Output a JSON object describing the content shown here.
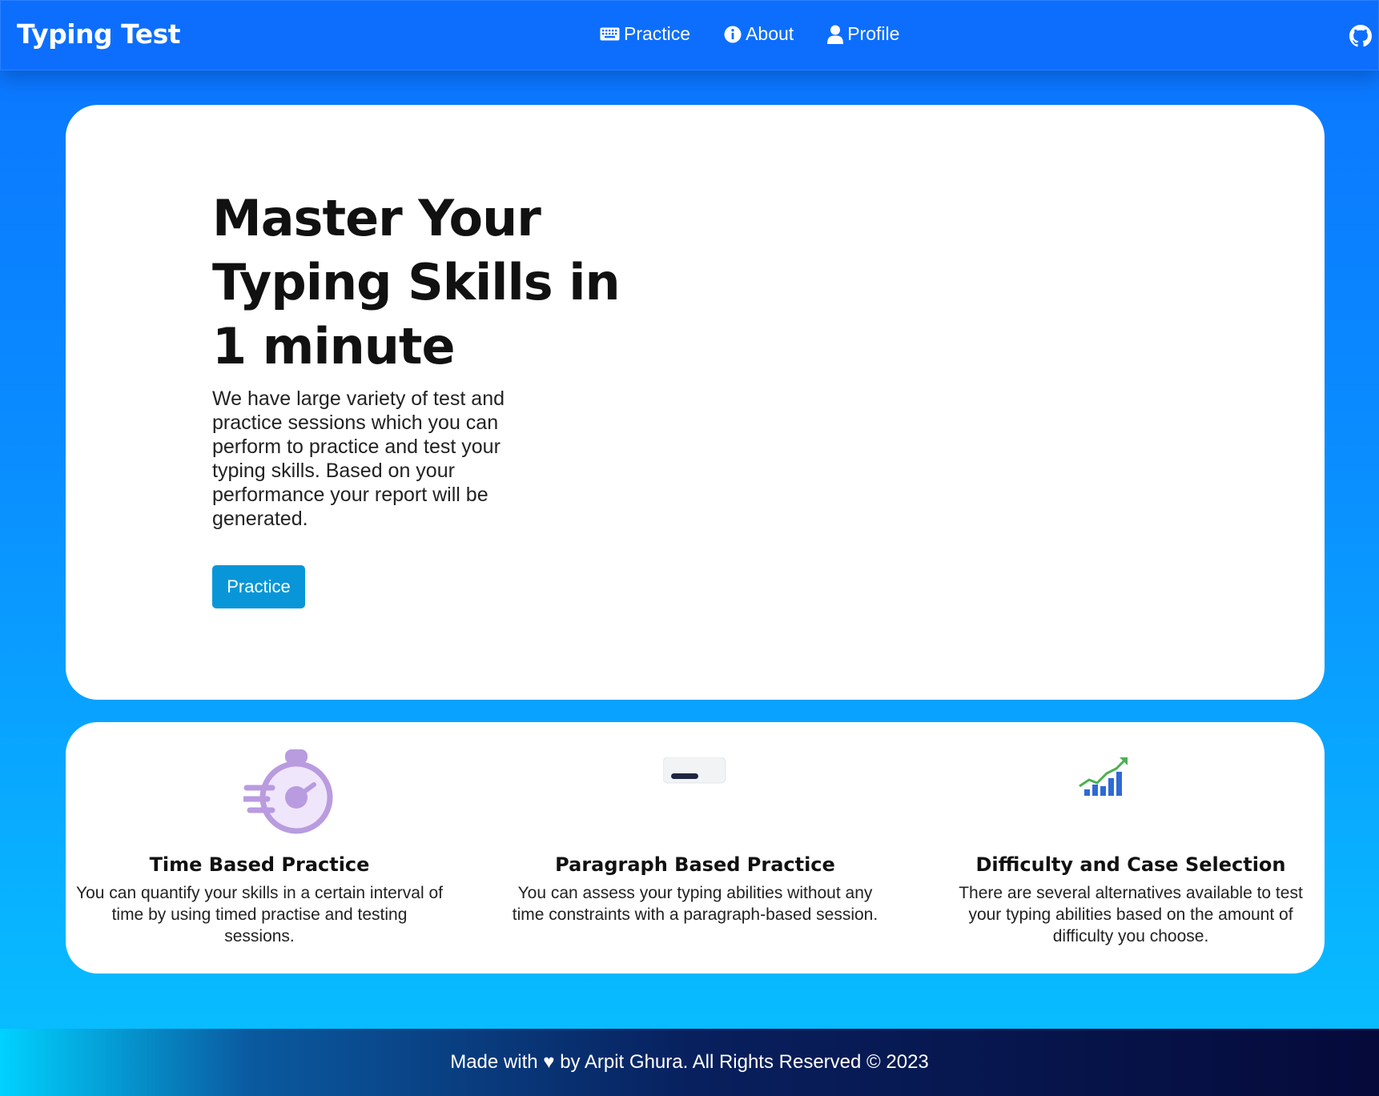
{
  "navbar": {
    "brand": "Typing Test",
    "links": [
      {
        "label": "Practice",
        "icon": "keyboard-icon"
      },
      {
        "label": "About",
        "icon": "info-icon"
      },
      {
        "label": "Profile",
        "icon": "user-icon"
      }
    ],
    "github_icon": "github-icon"
  },
  "hero": {
    "title": "Master Your Typing Skills in 1 minute",
    "description": "We have large variety of test and practice sessions which you can perform to practice and test your typing skills. Based on your performance your report will be generated.",
    "button_label": "Practice"
  },
  "features": [
    {
      "icon": "stopwatch-icon",
      "title": "Time Based Practice",
      "text": "You can quantify your skills in a certain interval of time by using timed practise and testing sessions."
    },
    {
      "icon": "keyboard-key-icon",
      "title": "Paragraph Based Practice",
      "text": "You can assess your typing abilities without any time constraints with a paragraph-based session."
    },
    {
      "icon": "growth-chart-icon",
      "title": "Difficulty and Case Selection",
      "text": "There are several alternatives available to test your typing abilities based on the amount of difficulty you choose."
    }
  ],
  "footer": {
    "text": "Made with ♥ by Arpit Ghura. All Rights Reserved © 2023"
  },
  "colors": {
    "navbar": "#0d6efd",
    "button": "#0896d8",
    "footer_dark": "#050a3a"
  }
}
